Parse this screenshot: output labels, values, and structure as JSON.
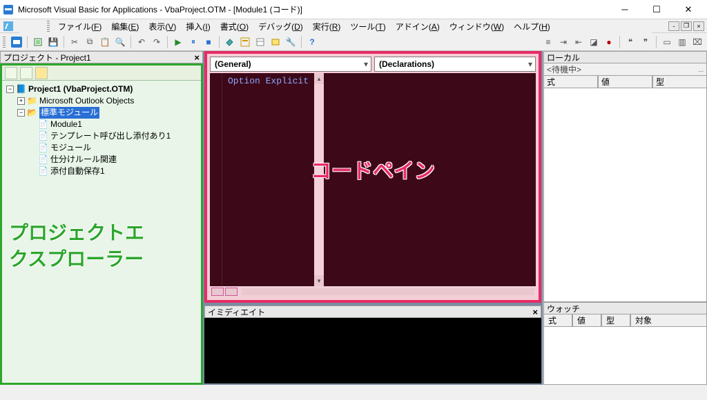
{
  "title": "Microsoft Visual Basic for Applications - VbaProject.OTM - [Module1 (コード)]",
  "menus": [
    "ファイル(F)",
    "編集(E)",
    "表示(V)",
    "挿入(I)",
    "書式(O)",
    "デバッグ(D)",
    "実行(R)",
    "ツール(T)",
    "アドイン(A)",
    "ウィンドウ(W)",
    "ヘルプ(H)"
  ],
  "project_explorer": {
    "header": "プロジェクト - Project1",
    "root": "Project1 (VbaProject.OTM)",
    "children": [
      {
        "label": "Microsoft Outlook Objects",
        "selected": false
      },
      {
        "label": "標準モジュール",
        "selected": true,
        "children": [
          "Module1",
          "テンプレート呼び出し添付あり1",
          "モジュール",
          "仕分けルール関連",
          "添付自動保存1"
        ]
      }
    ],
    "annotation": "プロジェクトエクスプローラー"
  },
  "code_pane": {
    "left_combo": "(General)",
    "right_combo": "(Declarations)",
    "code": "Option Explicit",
    "annotation": "コードペイン"
  },
  "immediate": {
    "header": "イミディエイト"
  },
  "locals": {
    "header": "ローカル",
    "status": "<待機中>",
    "columns": [
      "式",
      "値",
      "型"
    ]
  },
  "watch": {
    "header": "ウォッチ",
    "columns": [
      "式",
      "値",
      "型",
      "対象"
    ]
  }
}
